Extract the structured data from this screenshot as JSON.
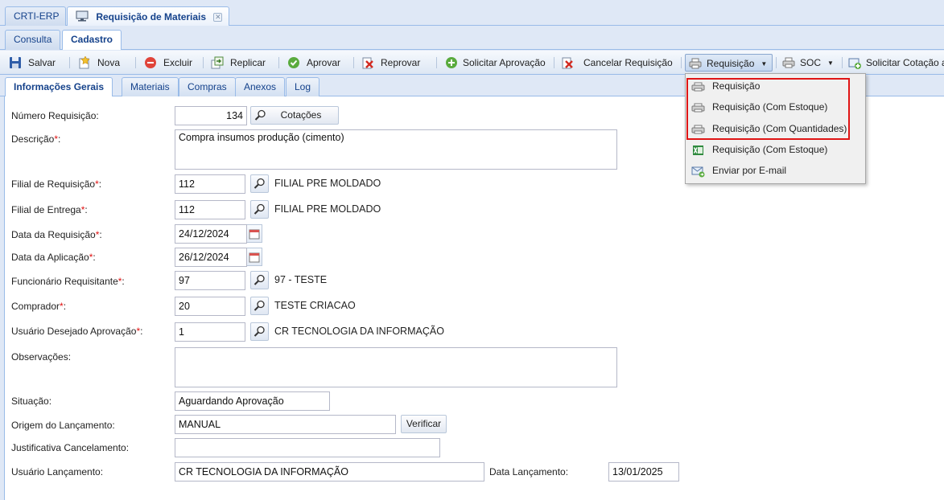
{
  "app_tabs": [
    {
      "label": "CRTI-ERP"
    },
    {
      "label": "Requisição de Materiais"
    }
  ],
  "mode_tabs": [
    {
      "label": "Consulta"
    },
    {
      "label": "Cadastro"
    }
  ],
  "toolbar": {
    "salvar": "Salvar",
    "nova": "Nova",
    "excluir": "Excluir",
    "replicar": "Replicar",
    "aprovar": "Aprovar",
    "reprovar": "Reprovar",
    "solicitar_aprovacao": "Solicitar Aprovação",
    "cancelar_requisicao": "Cancelar Requisição",
    "requisicao": "Requisição",
    "soc": "SOC",
    "solicitar_cotacao": "Solicitar Cotação a"
  },
  "sub_tabs": [
    {
      "label": "Informações Gerais"
    },
    {
      "label": "Materiais"
    },
    {
      "label": "Compras"
    },
    {
      "label": "Anexos"
    },
    {
      "label": "Log"
    }
  ],
  "form": {
    "numero_requisicao": {
      "label": "Número Requisição:",
      "value": "134",
      "button": "Cotações"
    },
    "descricao": {
      "label": "Descrição",
      "value": "Compra insumos produção   (cimento)"
    },
    "filial_requisicao": {
      "label": "Filial de Requisição",
      "value": "112",
      "desc": "FILIAL PRE MOLDADO"
    },
    "filial_entrega": {
      "label": "Filial de Entrega",
      "value": "112",
      "desc": "FILIAL PRE MOLDADO"
    },
    "data_requisicao": {
      "label": "Data da Requisição",
      "value": "24/12/2024"
    },
    "data_aplicacao": {
      "label": "Data da Aplicação",
      "value": "26/12/2024"
    },
    "funcionario": {
      "label": "Funcionário Requisitante",
      "value": "97",
      "desc": "97 - TESTE"
    },
    "comprador": {
      "label": "Comprador",
      "value": "20",
      "desc": "TESTE CRIACAO"
    },
    "usuario_aprovacao": {
      "label": "Usuário Desejado Aprovação",
      "value": "1",
      "desc": "CR TECNOLOGIA DA INFORMAÇÃO"
    },
    "observacoes": {
      "label": "Observações:",
      "value": ""
    },
    "situacao": {
      "label": "Situação:",
      "value": "Aguardando Aprovação"
    },
    "origem": {
      "label": "Origem do Lançamento:",
      "value": "MANUAL",
      "button": "Verificar"
    },
    "justificativa": {
      "label": "Justificativa Cancelamento:",
      "value": ""
    },
    "usuario_lancamento": {
      "label": "Usuário Lançamento:",
      "value": "CR TECNOLOGIA DA INFORMAÇÃO"
    },
    "data_lancamento": {
      "label": "Data Lançamento:",
      "value": "13/01/2025"
    },
    "required_mark": "*",
    "colon": ":"
  },
  "dropdown": {
    "items": [
      {
        "label": "Requisição",
        "icon": "printer-icon"
      },
      {
        "label": "Requisição (Com Estoque)",
        "icon": "printer-icon"
      },
      {
        "label": "Requisição (Com Quantidades)",
        "icon": "printer-icon"
      },
      {
        "label": "Requisição (Com Estoque)",
        "icon": "excel-icon"
      },
      {
        "label": "Enviar por E-mail",
        "icon": "email-icon"
      }
    ]
  },
  "colors": {
    "highlight": "#e01515",
    "required": "#e01010",
    "tab_text": "#15428b"
  }
}
